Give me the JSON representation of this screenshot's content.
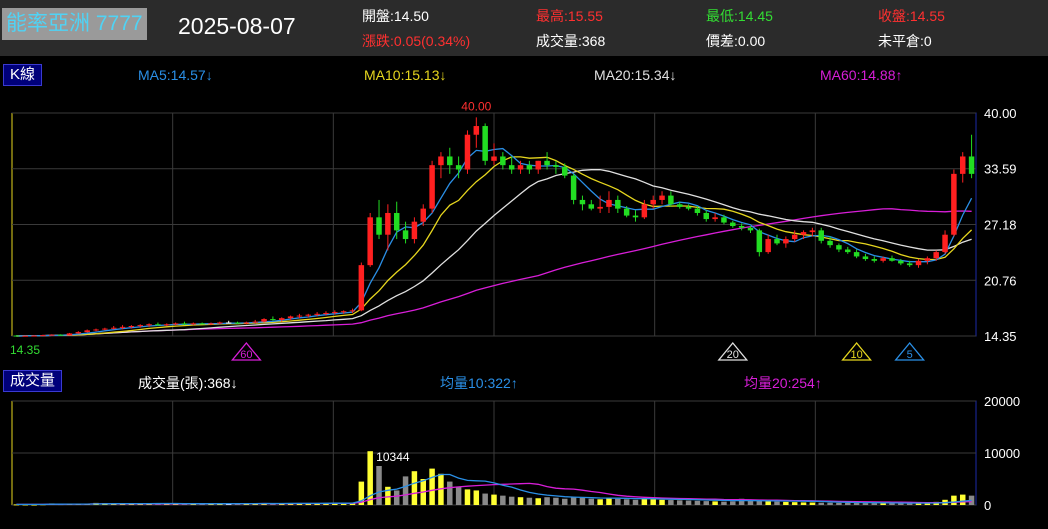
{
  "header": {
    "stock": "能率亞洲 7777",
    "date": "2025-08-07",
    "quote": {
      "open": "開盤:14.50",
      "high": "最高:15.55",
      "low": "最低:14.45",
      "close": "收盤:14.55",
      "change": "漲跌:0.05(0.34%)",
      "volume": "成交量:368",
      "spread": "價差:0.00",
      "open_interest": "未平倉:0"
    }
  },
  "kline": {
    "tag": "K線",
    "ma5": "MA5:14.57↓",
    "ma10": "MA10:15.13↓",
    "ma20": "MA20:15.34↓",
    "ma60": "MA60:14.88↑",
    "high_label": "40.00",
    "low_label": "14.35",
    "markers": [
      "60",
      "20",
      "10",
      "5"
    ]
  },
  "volume_panel": {
    "tag": "成交量",
    "vol": "成交量(張):368↓",
    "avg10": "均量10:322↑",
    "avg20": "均量20:254↑",
    "peak_label": "10344"
  },
  "colors": {
    "up": "#ff2020",
    "down": "#22dd22",
    "doji": "#ffffff",
    "ma5": "#2a8fe6",
    "ma10": "#e6d61e",
    "ma20": "#e0e0e0",
    "ma60": "#d81ed8",
    "vol_up": "#ffff33",
    "vol_down": "#8a8a8a"
  },
  "chart_data": [
    {
      "type": "candlestick",
      "y_ticks": [
        "40.00",
        "33.59",
        "27.18",
        "20.76",
        "14.35"
      ],
      "ylim": [
        14.35,
        40.0
      ],
      "candles": [
        [
          14.4,
          14.45,
          14.3,
          14.35
        ],
        [
          14.35,
          14.4,
          14.3,
          14.38
        ],
        [
          14.38,
          14.45,
          14.35,
          14.4
        ],
        [
          14.4,
          14.5,
          14.35,
          14.45
        ],
        [
          14.45,
          14.55,
          14.4,
          14.5
        ],
        [
          14.5,
          14.55,
          14.4,
          14.42
        ],
        [
          14.42,
          14.7,
          14.4,
          14.65
        ],
        [
          14.65,
          14.9,
          14.6,
          14.8
        ],
        [
          14.8,
          15.1,
          14.75,
          15.0
        ],
        [
          15.0,
          15.2,
          14.9,
          15.1
        ],
        [
          15.1,
          15.3,
          15.0,
          15.2
        ],
        [
          15.2,
          15.5,
          15.1,
          15.3
        ],
        [
          15.3,
          15.6,
          15.1,
          15.4
        ],
        [
          15.4,
          15.6,
          15.2,
          15.5
        ],
        [
          15.5,
          15.7,
          15.3,
          15.6
        ],
        [
          15.6,
          15.8,
          15.4,
          15.7
        ],
        [
          15.7,
          15.9,
          15.5,
          15.6
        ],
        [
          15.6,
          15.8,
          15.5,
          15.7
        ],
        [
          15.7,
          15.9,
          15.6,
          15.8
        ],
        [
          15.8,
          16.0,
          15.6,
          15.7
        ],
        [
          15.7,
          15.9,
          15.6,
          15.8
        ],
        [
          15.8,
          15.9,
          15.7,
          15.7
        ],
        [
          15.7,
          15.9,
          15.6,
          15.8
        ],
        [
          15.8,
          16.0,
          15.7,
          15.9
        ],
        [
          15.9,
          16.1,
          15.8,
          15.9
        ],
        [
          15.9,
          16.0,
          15.7,
          15.8
        ],
        [
          15.8,
          16.0,
          15.7,
          15.9
        ],
        [
          15.9,
          16.2,
          15.8,
          16.0
        ],
        [
          16.0,
          16.4,
          15.9,
          16.3
        ],
        [
          16.3,
          16.6,
          16.1,
          16.2
        ],
        [
          16.2,
          16.5,
          16.0,
          16.4
        ],
        [
          16.4,
          16.7,
          16.2,
          16.6
        ],
        [
          16.6,
          16.9,
          16.4,
          16.7
        ],
        [
          16.7,
          16.9,
          16.5,
          16.8
        ],
        [
          16.8,
          17.1,
          16.6,
          16.9
        ],
        [
          16.9,
          17.2,
          16.7,
          17.0
        ],
        [
          17.0,
          17.3,
          16.8,
          17.1
        ],
        [
          17.1,
          17.3,
          16.9,
          17.2
        ],
        [
          17.2,
          17.5,
          17.0,
          17.3
        ],
        [
          17.3,
          22.8,
          17.2,
          22.5
        ],
        [
          22.5,
          28.5,
          22.3,
          28.0
        ],
        [
          28.0,
          30.0,
          25.5,
          26.0
        ],
        [
          26.0,
          29.5,
          24.2,
          28.5
        ],
        [
          28.5,
          29.8,
          25.5,
          26.5
        ],
        [
          26.5,
          27.5,
          25.0,
          25.5
        ],
        [
          25.5,
          28.0,
          25.0,
          27.5
        ],
        [
          27.5,
          29.5,
          27.0,
          29.0
        ],
        [
          29.0,
          34.5,
          28.5,
          34.0
        ],
        [
          34.0,
          35.5,
          32.5,
          35.0
        ],
        [
          35.0,
          36.0,
          33.0,
          34.0
        ],
        [
          34.0,
          35.0,
          32.5,
          33.5
        ],
        [
          33.5,
          38.0,
          33.0,
          37.5
        ],
        [
          37.5,
          39.5,
          36.0,
          38.5
        ],
        [
          38.5,
          38.8,
          34.0,
          34.5
        ],
        [
          34.5,
          36.5,
          34.0,
          35.0
        ],
        [
          35.0,
          35.5,
          33.5,
          34.0
        ],
        [
          34.0,
          35.0,
          33.0,
          33.5
        ],
        [
          33.5,
          34.5,
          33.0,
          34.0
        ],
        [
          34.0,
          34.5,
          33.0,
          33.5
        ],
        [
          33.5,
          34.5,
          33.0,
          34.5
        ],
        [
          34.5,
          35.5,
          33.5,
          34.0
        ],
        [
          34.0,
          34.5,
          33.0,
          33.8
        ],
        [
          33.8,
          34.2,
          32.5,
          32.8
        ],
        [
          32.8,
          33.0,
          29.5,
          30.0
        ],
        [
          30.0,
          30.5,
          28.8,
          29.5
        ],
        [
          29.5,
          30.0,
          28.8,
          29.0
        ],
        [
          29.0,
          30.5,
          28.5,
          29.2
        ],
        [
          29.2,
          31.0,
          28.5,
          30.0
        ],
        [
          30.0,
          30.5,
          28.5,
          29.0
        ],
        [
          29.0,
          29.3,
          28.0,
          28.2
        ],
        [
          28.2,
          28.8,
          27.5,
          28.0
        ],
        [
          28.0,
          30.0,
          27.8,
          29.5
        ],
        [
          29.5,
          30.5,
          29.0,
          30.0
        ],
        [
          30.0,
          31.0,
          29.5,
          30.5
        ],
        [
          30.5,
          31.0,
          29.2,
          29.5
        ],
        [
          29.5,
          29.8,
          29.0,
          29.2
        ],
        [
          29.2,
          29.5,
          28.8,
          29.0
        ],
        [
          29.0,
          29.3,
          28.2,
          28.5
        ],
        [
          28.5,
          28.8,
          27.5,
          27.8
        ],
        [
          27.8,
          28.5,
          27.5,
          28.0
        ],
        [
          28.0,
          28.3,
          27.2,
          27.4
        ],
        [
          27.4,
          27.6,
          26.8,
          27.0
        ],
        [
          27.0,
          27.3,
          26.5,
          26.8
        ],
        [
          26.8,
          27.0,
          26.2,
          26.5
        ],
        [
          26.5,
          26.7,
          23.5,
          24.0
        ],
        [
          24.0,
          26.0,
          23.8,
          25.5
        ],
        [
          25.5,
          26.0,
          24.8,
          25.0
        ],
        [
          25.0,
          25.8,
          24.5,
          25.5
        ],
        [
          25.5,
          26.5,
          25.2,
          26.0
        ],
        [
          26.0,
          26.5,
          25.5,
          26.3
        ],
        [
          26.3,
          26.8,
          25.8,
          26.5
        ],
        [
          26.5,
          26.8,
          25.0,
          25.3
        ],
        [
          25.3,
          25.8,
          24.5,
          24.8
        ],
        [
          24.8,
          25.0,
          24.0,
          24.3
        ],
        [
          24.3,
          24.6,
          23.8,
          24.0
        ],
        [
          24.0,
          24.3,
          23.3,
          23.5
        ],
        [
          23.5,
          23.8,
          23.0,
          23.2
        ],
        [
          23.2,
          23.5,
          22.8,
          23.0
        ],
        [
          23.0,
          23.5,
          22.8,
          23.3
        ],
        [
          23.3,
          23.6,
          22.9,
          23.0
        ],
        [
          23.0,
          23.2,
          22.5,
          22.7
        ],
        [
          22.7,
          23.0,
          22.3,
          22.5
        ],
        [
          22.5,
          23.2,
          22.2,
          23.0
        ],
        [
          23.0,
          23.5,
          22.6,
          23.3
        ],
        [
          23.3,
          24.2,
          23.0,
          24.0
        ],
        [
          24.0,
          26.5,
          23.8,
          26.0
        ],
        [
          26.0,
          33.5,
          25.8,
          33.0
        ],
        [
          33.0,
          35.5,
          32.0,
          35.0
        ],
        [
          35.0,
          37.5,
          32.5,
          33.0
        ]
      ]
    },
    {
      "type": "bar",
      "y_ticks": [
        "20000",
        "10000",
        "0"
      ],
      "ylim": [
        0,
        20000
      ],
      "values": [
        120,
        110,
        90,
        150,
        300,
        180,
        200,
        250,
        220,
        400,
        380,
        260,
        280,
        300,
        220,
        240,
        260,
        250,
        230,
        260,
        240,
        250,
        280,
        260,
        300,
        290,
        260,
        300,
        350,
        330,
        300,
        320,
        340,
        360,
        320,
        380,
        400,
        420,
        450,
        4500,
        10344,
        7500,
        3500,
        2800,
        5500,
        6500,
        5000,
        7000,
        6000,
        4500,
        3500,
        3000,
        2800,
        2200,
        2000,
        1800,
        1600,
        1500,
        1400,
        1300,
        1500,
        1400,
        1200,
        1500,
        1400,
        1200,
        1100,
        1300,
        1200,
        1100,
        1000,
        1200,
        1100,
        1000,
        950,
        900,
        850,
        800,
        750,
        700,
        650,
        700,
        1200,
        900,
        800,
        700,
        650,
        600,
        550,
        500,
        480,
        450,
        430,
        420,
        400,
        380,
        370,
        360,
        350,
        340,
        330,
        320,
        310,
        400,
        600,
        1000,
        1800,
        2000,
        1800
      ],
      "up": [
        1,
        1,
        1,
        1,
        1,
        0,
        1,
        1,
        1,
        1,
        1,
        1,
        1,
        1,
        1,
        1,
        0,
        1,
        1,
        0,
        1,
        0,
        1,
        1,
        2,
        0,
        1,
        1,
        1,
        0,
        1,
        1,
        1,
        1,
        1,
        1,
        1,
        1,
        1,
        1,
        1,
        0,
        1,
        0,
        0,
        1,
        1,
        1,
        1,
        0,
        0,
        1,
        1,
        0,
        1,
        0,
        0,
        1,
        0,
        1,
        0,
        0,
        0,
        0,
        0,
        0,
        1,
        1,
        0,
        0,
        0,
        1,
        1,
        1,
        0,
        0,
        0,
        0,
        0,
        1,
        0,
        0,
        0,
        0,
        0,
        1,
        0,
        1,
        1,
        1,
        1,
        0,
        0,
        0,
        0,
        0,
        0,
        0,
        1,
        0,
        0,
        0,
        1,
        1,
        1,
        1,
        1,
        1,
        0
      ]
    }
  ]
}
